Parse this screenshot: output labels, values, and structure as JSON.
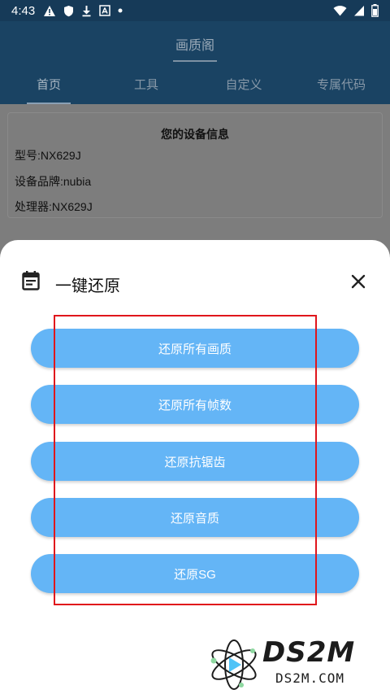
{
  "status_bar": {
    "time": "4:43"
  },
  "app_bar": {
    "title": "画质阁",
    "tabs": [
      {
        "label": "首页",
        "active": true
      },
      {
        "label": "工具",
        "active": false
      },
      {
        "label": "自定义",
        "active": false
      },
      {
        "label": "专属代码",
        "active": false
      }
    ]
  },
  "device_info": {
    "title": "您的设备信息",
    "model": "型号:NX629J",
    "brand": "设备品牌:nubia",
    "processor": "处理器:NX629J"
  },
  "sheet": {
    "title": "一键还原",
    "buttons": [
      {
        "label": "还原所有画质"
      },
      {
        "label": "还原所有帧数"
      },
      {
        "label": "还原抗锯齿"
      },
      {
        "label": "还原音质"
      },
      {
        "label": "还原SG"
      }
    ]
  },
  "watermark": {
    "main": "DS2M",
    "sub": "DS2M.COM"
  },
  "colors": {
    "button": "#64b5f6",
    "app_bar": "#1a4363",
    "highlight": "#e0161c"
  }
}
